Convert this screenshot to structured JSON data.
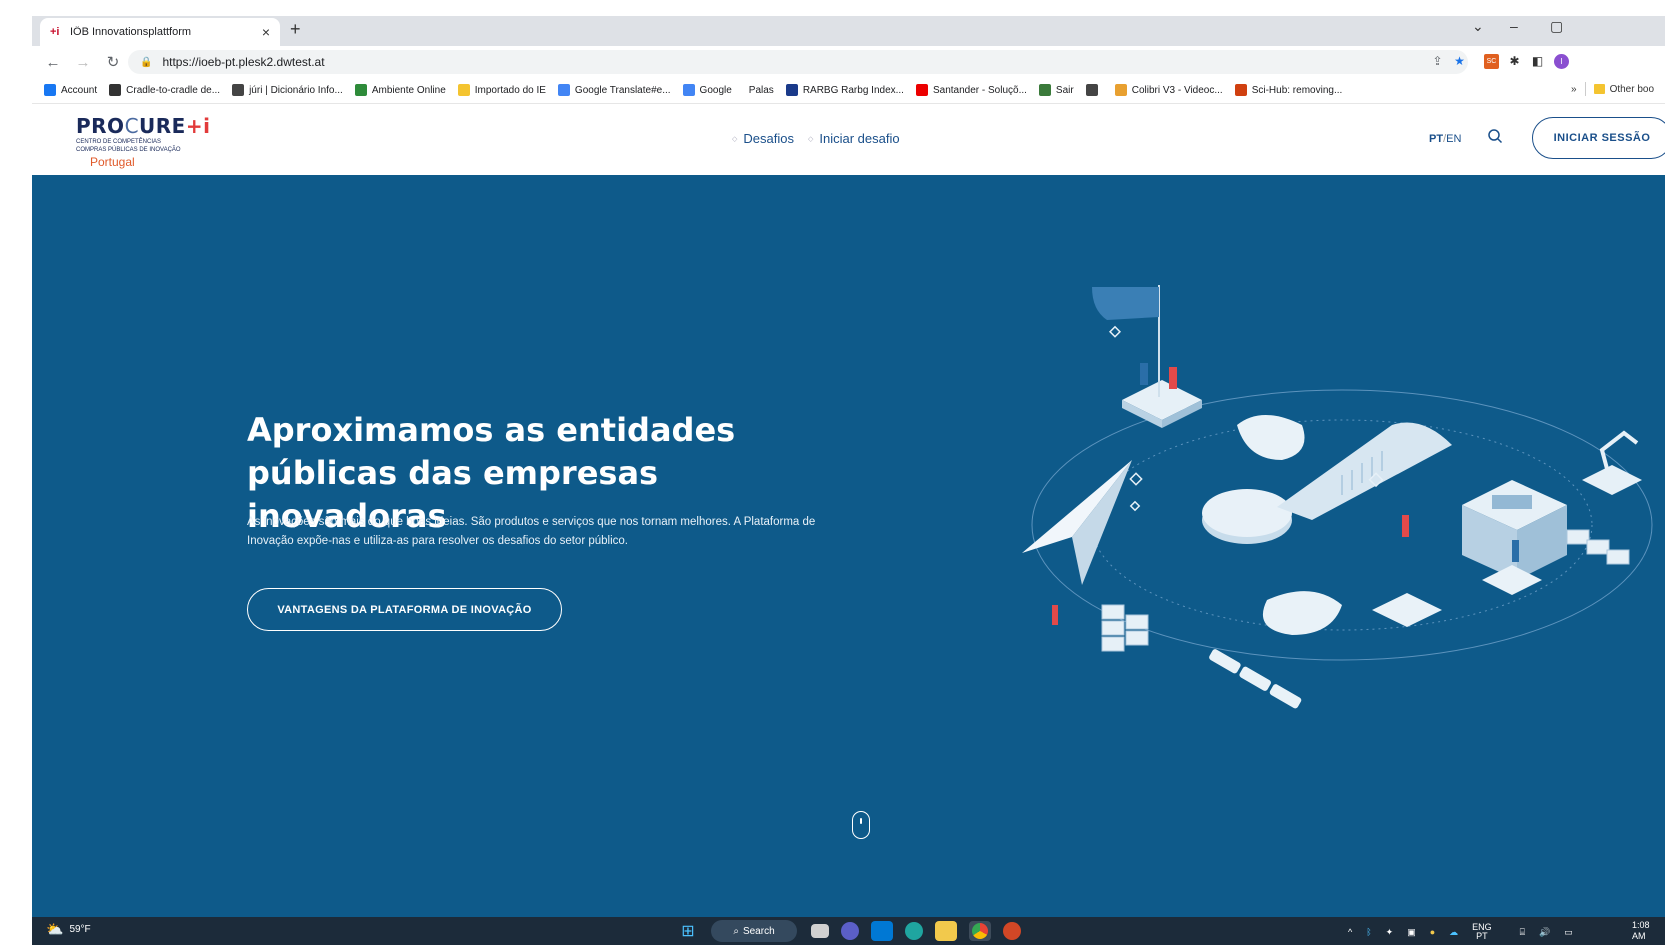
{
  "browser": {
    "tab_title": "IÖB Innovationsplattform",
    "tab_favicon": "+i",
    "url": "https://ioeb-pt.plesk2.dwtest.at",
    "close_glyph": "×",
    "new_tab_glyph": "+"
  },
  "bookmarks": [
    {
      "label": "Account",
      "icon": "facebook-icon",
      "color": "#1877f2"
    },
    {
      "label": "Cradle-to-cradle de...",
      "icon": "wikipedia-icon",
      "color": "#333333"
    },
    {
      "label": "júri | Dicionário Info...",
      "icon": "globe-icon",
      "color": "#444444"
    },
    {
      "label": "Ambiente Online",
      "icon": "tree-icon",
      "color": "#2e8b3a"
    },
    {
      "label": "Importado do IE",
      "icon": "folder-icon",
      "color": "#f4c430"
    },
    {
      "label": "Google Translate#e...",
      "icon": "translate-icon",
      "color": "#4285f4"
    },
    {
      "label": "Google",
      "icon": "google-icon",
      "color": "#4285f4"
    },
    {
      "label": "Palas",
      "icon": "blank-icon",
      "color": "#ffffff"
    },
    {
      "label": "RARBG Rarbg Index...",
      "icon": "rarbg-icon",
      "color": "#1a3a8a"
    },
    {
      "label": "Santander - Soluçõ...",
      "icon": "santander-icon",
      "color": "#ec0000"
    },
    {
      "label": "Sair",
      "icon": "sair-icon",
      "color": "#3a7a3a"
    },
    {
      "label": "",
      "icon": "globe-icon",
      "color": "#444444"
    },
    {
      "label": "Colibri V3 - Videoc...",
      "icon": "colibri-icon",
      "color": "#e8a030"
    },
    {
      "label": "Sci-Hub: removing...",
      "icon": "scihub-icon",
      "color": "#d04010"
    }
  ],
  "bookmarks_more": "»",
  "bookmarks_other": "Other boo",
  "site": {
    "logo_main": "PRO",
    "logo_swirl": "C",
    "logo_main2": "URE",
    "logo_plus": "+i",
    "logo_sub1": "CENTRO DE COMPETÊNCIAS",
    "logo_sub2": "COMPRAS PÚBLICAS DE INOVAÇÃO",
    "logo_country": "Portugal",
    "nav": [
      "Desafios",
      "Iniciar desafio"
    ],
    "lang_active": "PT",
    "lang_sep": "/",
    "lang_other": "EN",
    "login_label": "INICIAR SESSÃO"
  },
  "hero": {
    "title_line1": "Aproximamos as entidades",
    "title_line2": "públicas das empresas inovadoras",
    "body": "As inovações são mais do que boas ideias. São produtos e serviços que nos tornam melhores. A Plataforma de Inovação expõe-nas e utiliza-as para resolver os desafios do setor público.",
    "cta": "VANTAGENS DA PLATAFORMA DE INOVAÇÃO",
    "bg_color": "#0e5a8a"
  },
  "taskbar": {
    "temperature": "59°F",
    "search_label": "Search",
    "lang_top": "ENG",
    "lang_bottom": "PT",
    "time": "1:08 AM"
  }
}
